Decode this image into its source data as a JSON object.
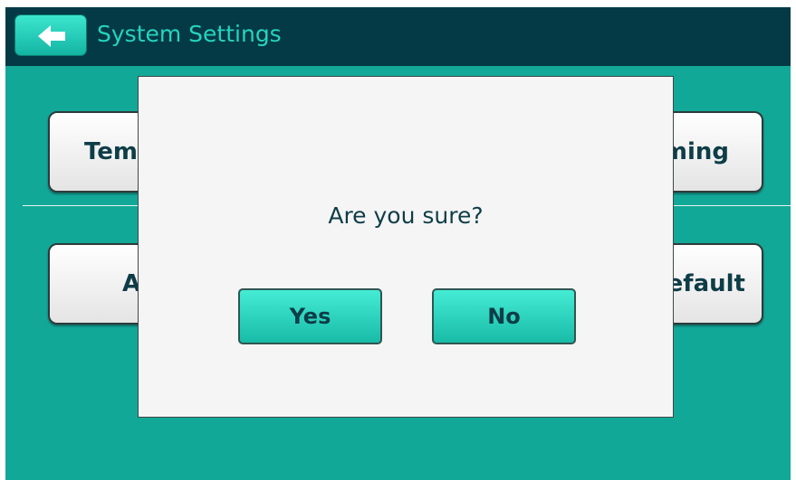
{
  "header": {
    "title": "System Settings",
    "back_icon": "arrow-left-icon"
  },
  "settings": {
    "top_left_label": "Temperature",
    "top_right_label": "Timing",
    "bottom_left_label": "About",
    "bottom_right_label": "Default"
  },
  "dialog": {
    "message": "Are you sure?",
    "yes_label": "Yes",
    "no_label": "No"
  },
  "colors": {
    "header_bg": "#043a45",
    "screen_bg": "#12a898",
    "accent": "#25d4bf",
    "text_dark": "#0e3d47"
  }
}
